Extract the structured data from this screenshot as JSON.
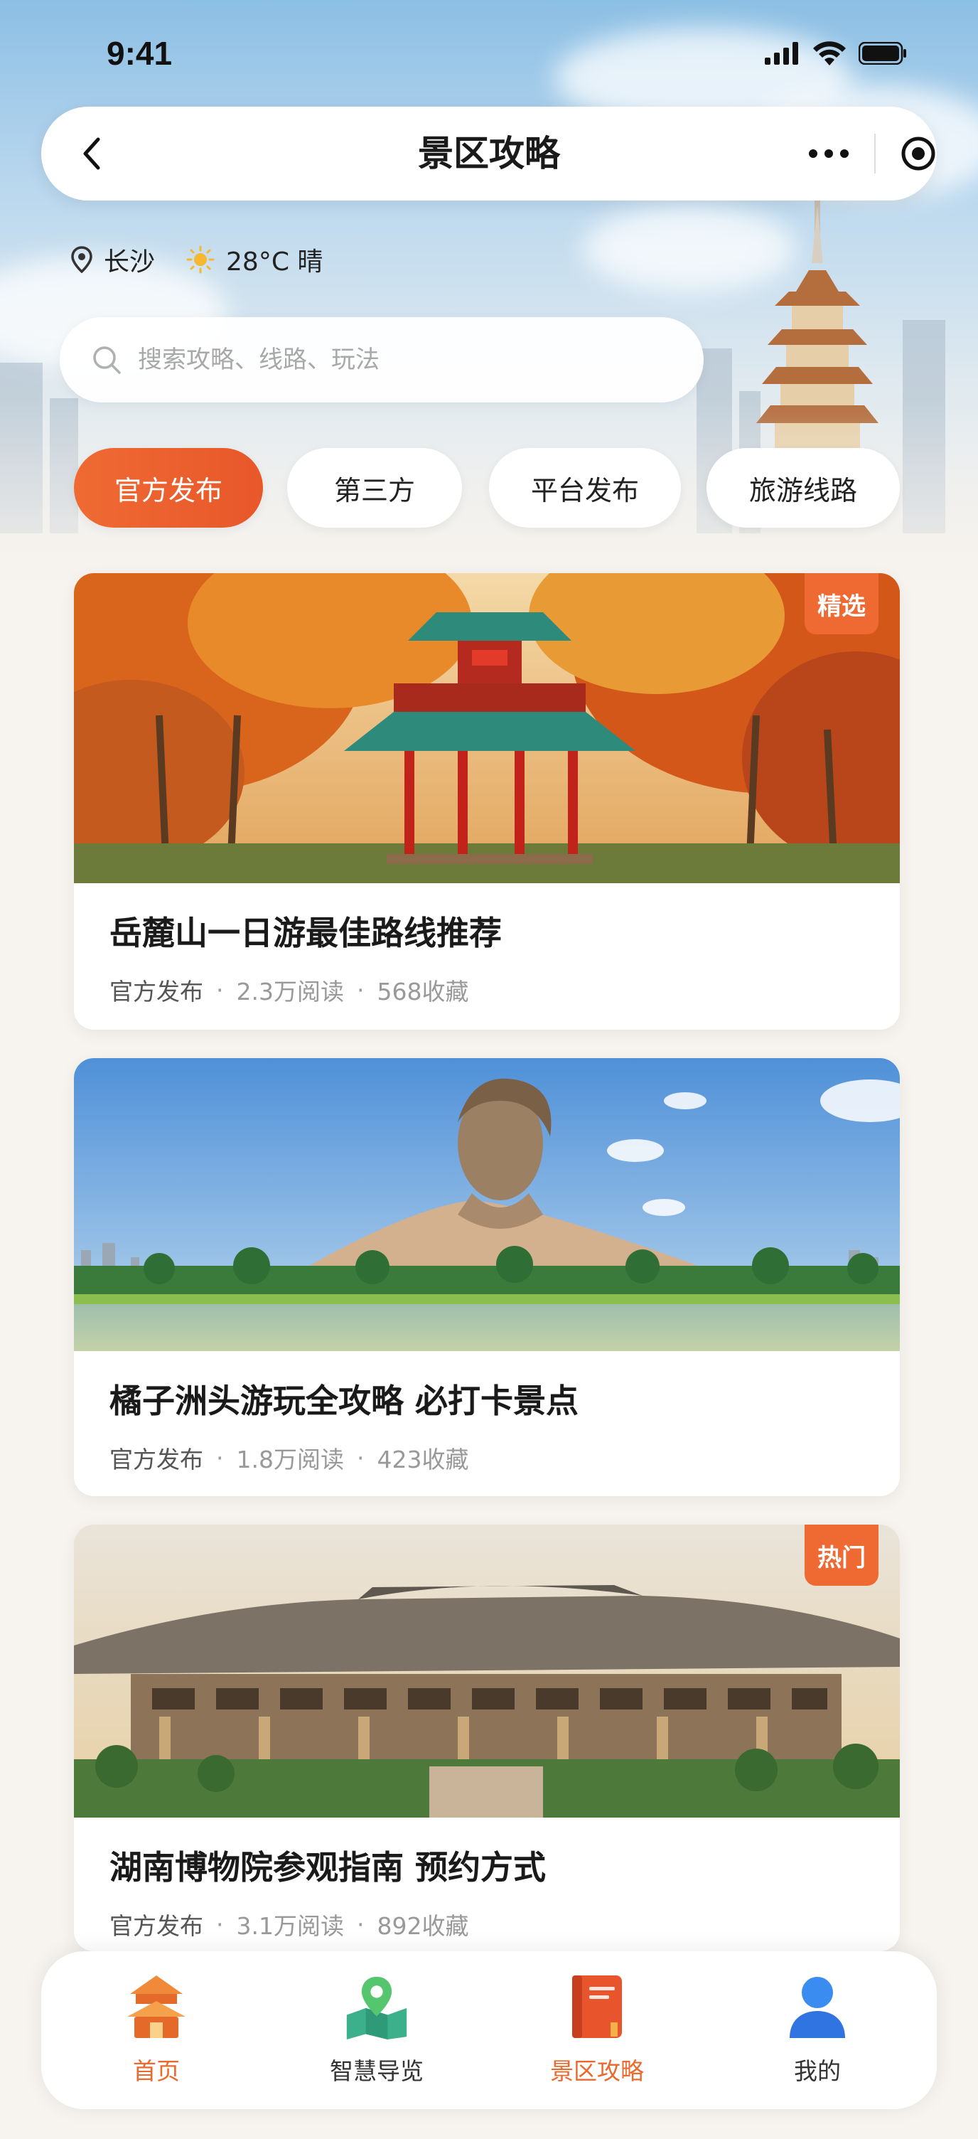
{
  "status_bar": {
    "time": "9:41"
  },
  "nav": {
    "title": "景区攻略"
  },
  "location": {
    "city": "长沙",
    "weather": "28°C 晴"
  },
  "search": {
    "placeholder": "搜索攻略、线路、玩法"
  },
  "tabs": [
    {
      "label": "官方发布",
      "active": true
    },
    {
      "label": "第三方",
      "active": false
    },
    {
      "label": "平台发布",
      "active": false
    },
    {
      "label": "旅游线路",
      "active": false
    }
  ],
  "articles": [
    {
      "title": "岳麓山一日游最佳路线推荐",
      "source": "官方发布",
      "reads": "2.3万阅读",
      "favorites": "568收藏",
      "badge": "精选"
    },
    {
      "title": "橘子洲头游玩全攻略 必打卡景点",
      "source": "官方发布",
      "reads": "1.8万阅读",
      "favorites": "423收藏",
      "badge": ""
    },
    {
      "title": "湖南博物院参观指南 预约方式",
      "source": "官方发布",
      "reads": "3.1万阅读",
      "favorites": "892收藏",
      "badge": "热门"
    }
  ],
  "bottom_nav": [
    {
      "label": "首页",
      "icon": "pavilion-home-icon",
      "active": true
    },
    {
      "label": "智慧导览",
      "icon": "map-pin-icon",
      "active": false
    },
    {
      "label": "景区攻略",
      "icon": "guide-book-icon",
      "active": true
    },
    {
      "label": "我的",
      "icon": "user-icon",
      "active": false
    }
  ],
  "colors": {
    "accent": "#ea6a2e",
    "background": "#f7f3ee"
  }
}
